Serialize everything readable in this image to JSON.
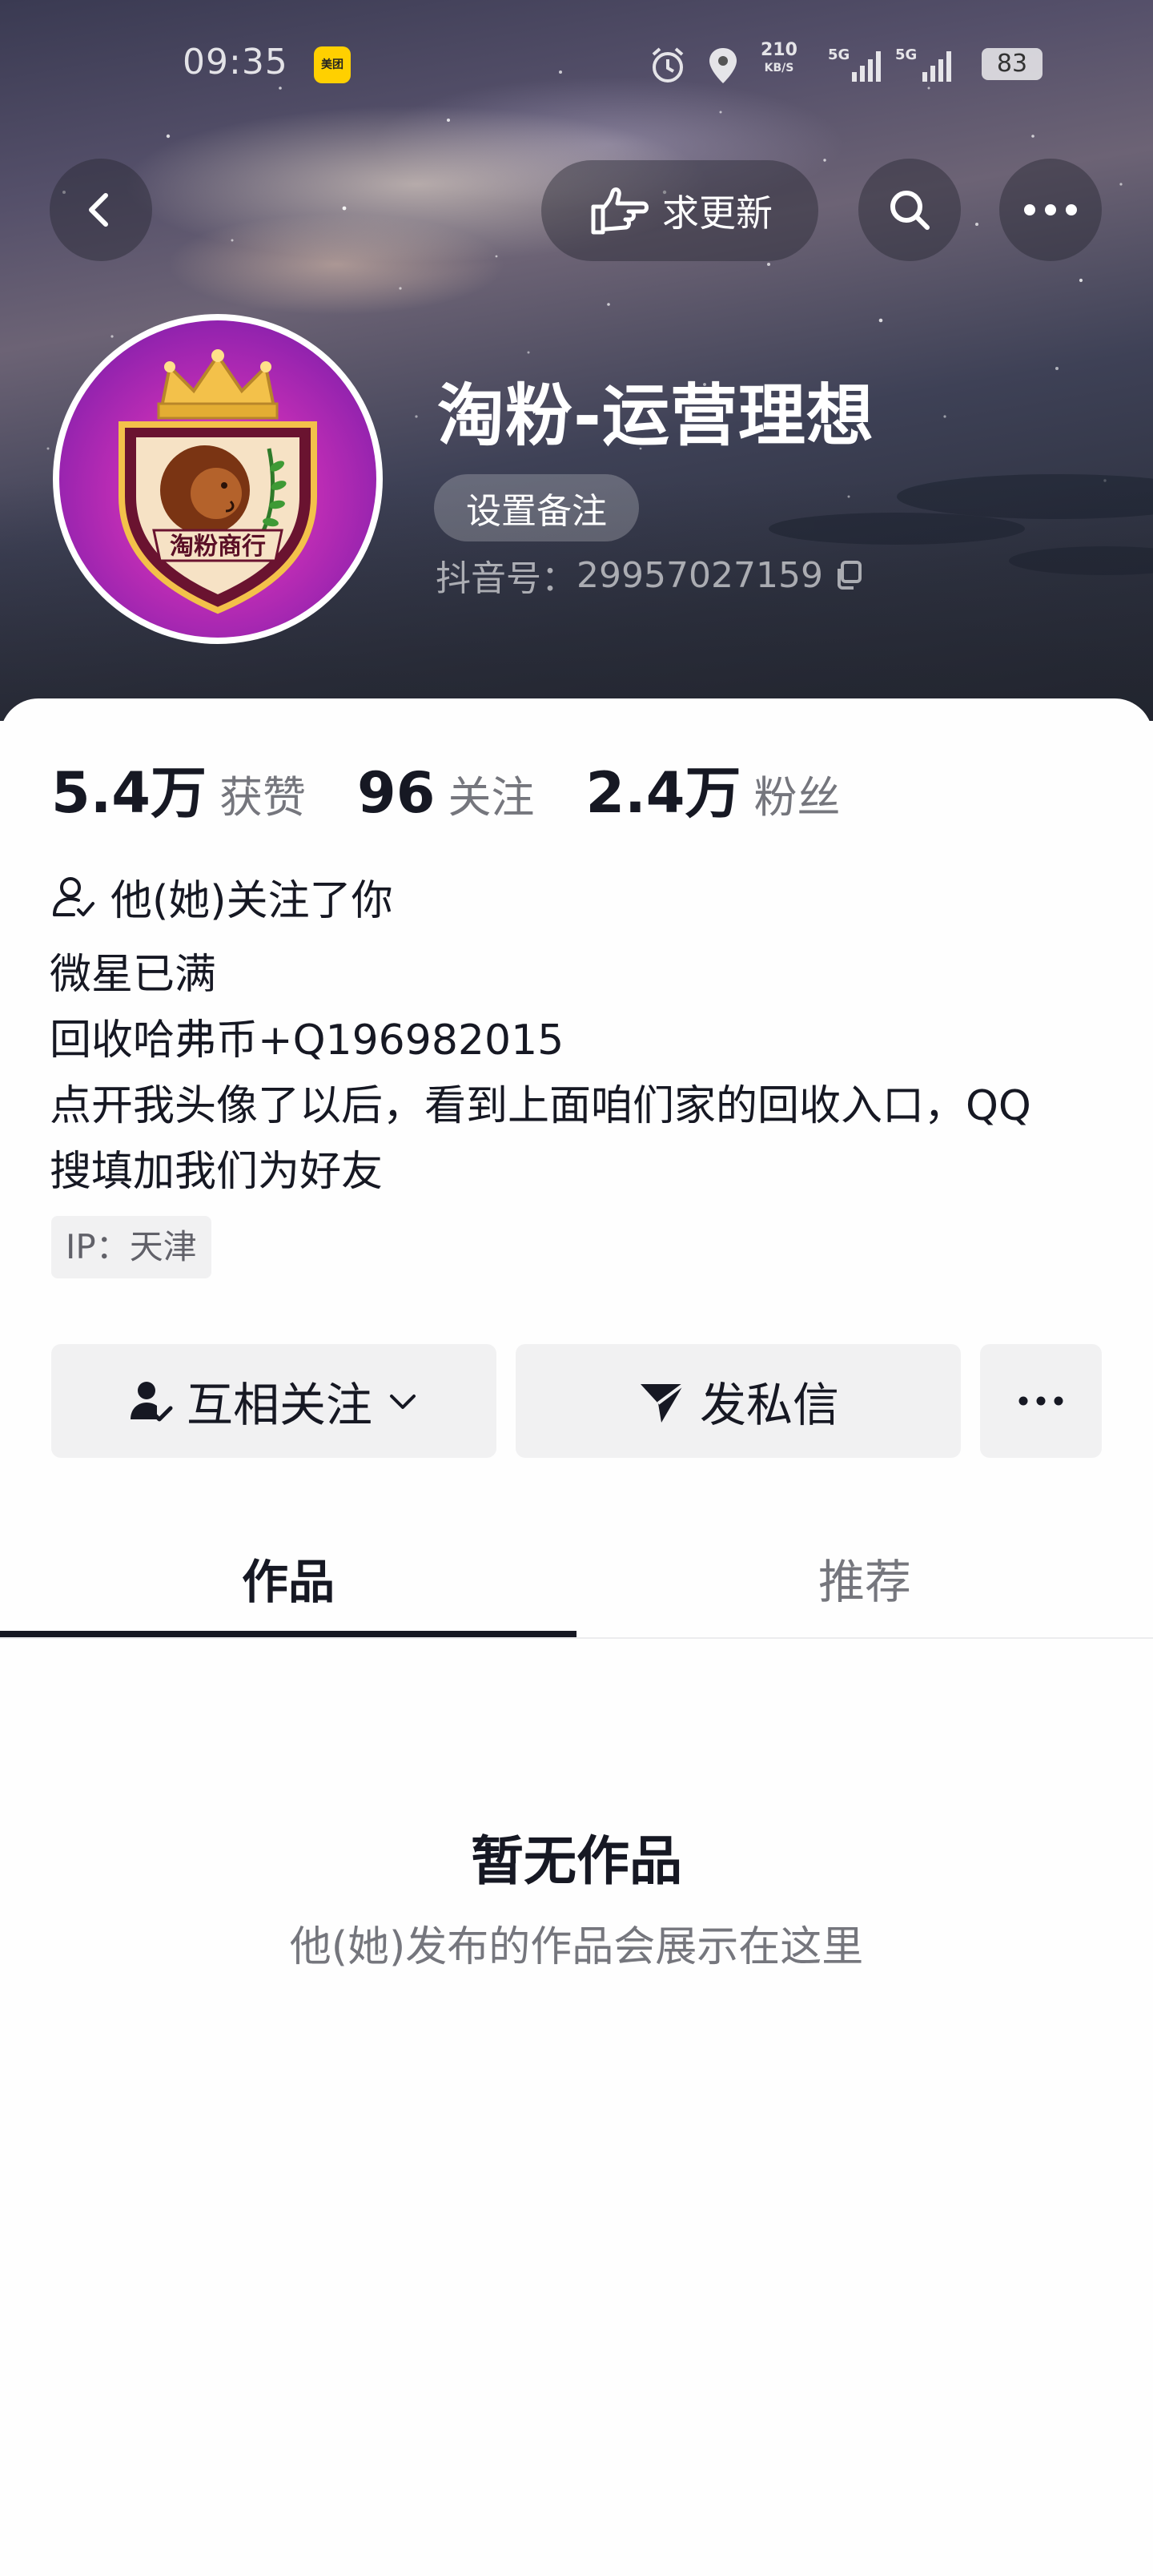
{
  "status_bar": {
    "time": "09:35",
    "meituan_label": "美团",
    "network_speed": "210",
    "network_unit": "KB/S",
    "signal_1": "5G",
    "signal_2": "5G",
    "battery": "83"
  },
  "nav": {
    "back_icon": "chevron-left-icon",
    "request_update_label": "求更新",
    "search_icon": "search-icon",
    "more_icon": "more-horizontal-icon"
  },
  "profile": {
    "avatar_text": "淘粉商行",
    "nickname": "淘粉-运营理想",
    "remark_button": "设置备注",
    "douyin_id_label": "抖音号：",
    "douyin_id": "29957027159"
  },
  "stats": [
    {
      "value": "5.4万",
      "label": "获赞"
    },
    {
      "value": "96",
      "label": "关注"
    },
    {
      "value": "2.4万",
      "label": "粉丝"
    }
  ],
  "follow_status": "他(她)关注了你",
  "bio_lines": [
    "微星已满",
    "回收哈弗币+Q196982015",
    "点开我头像了以后，看到上面咱们家的回收入口，QQ",
    "搜填加我们为好友"
  ],
  "ip_location": "IP：天津",
  "actions": {
    "mutual_follow": "互相关注",
    "send_message": "发私信"
  },
  "tabs": [
    {
      "label": "作品",
      "active": true
    },
    {
      "label": "推荐",
      "active": false
    }
  ],
  "empty_state": {
    "title": "暂无作品",
    "subtitle": "他(她)发布的作品会展示在这里"
  }
}
